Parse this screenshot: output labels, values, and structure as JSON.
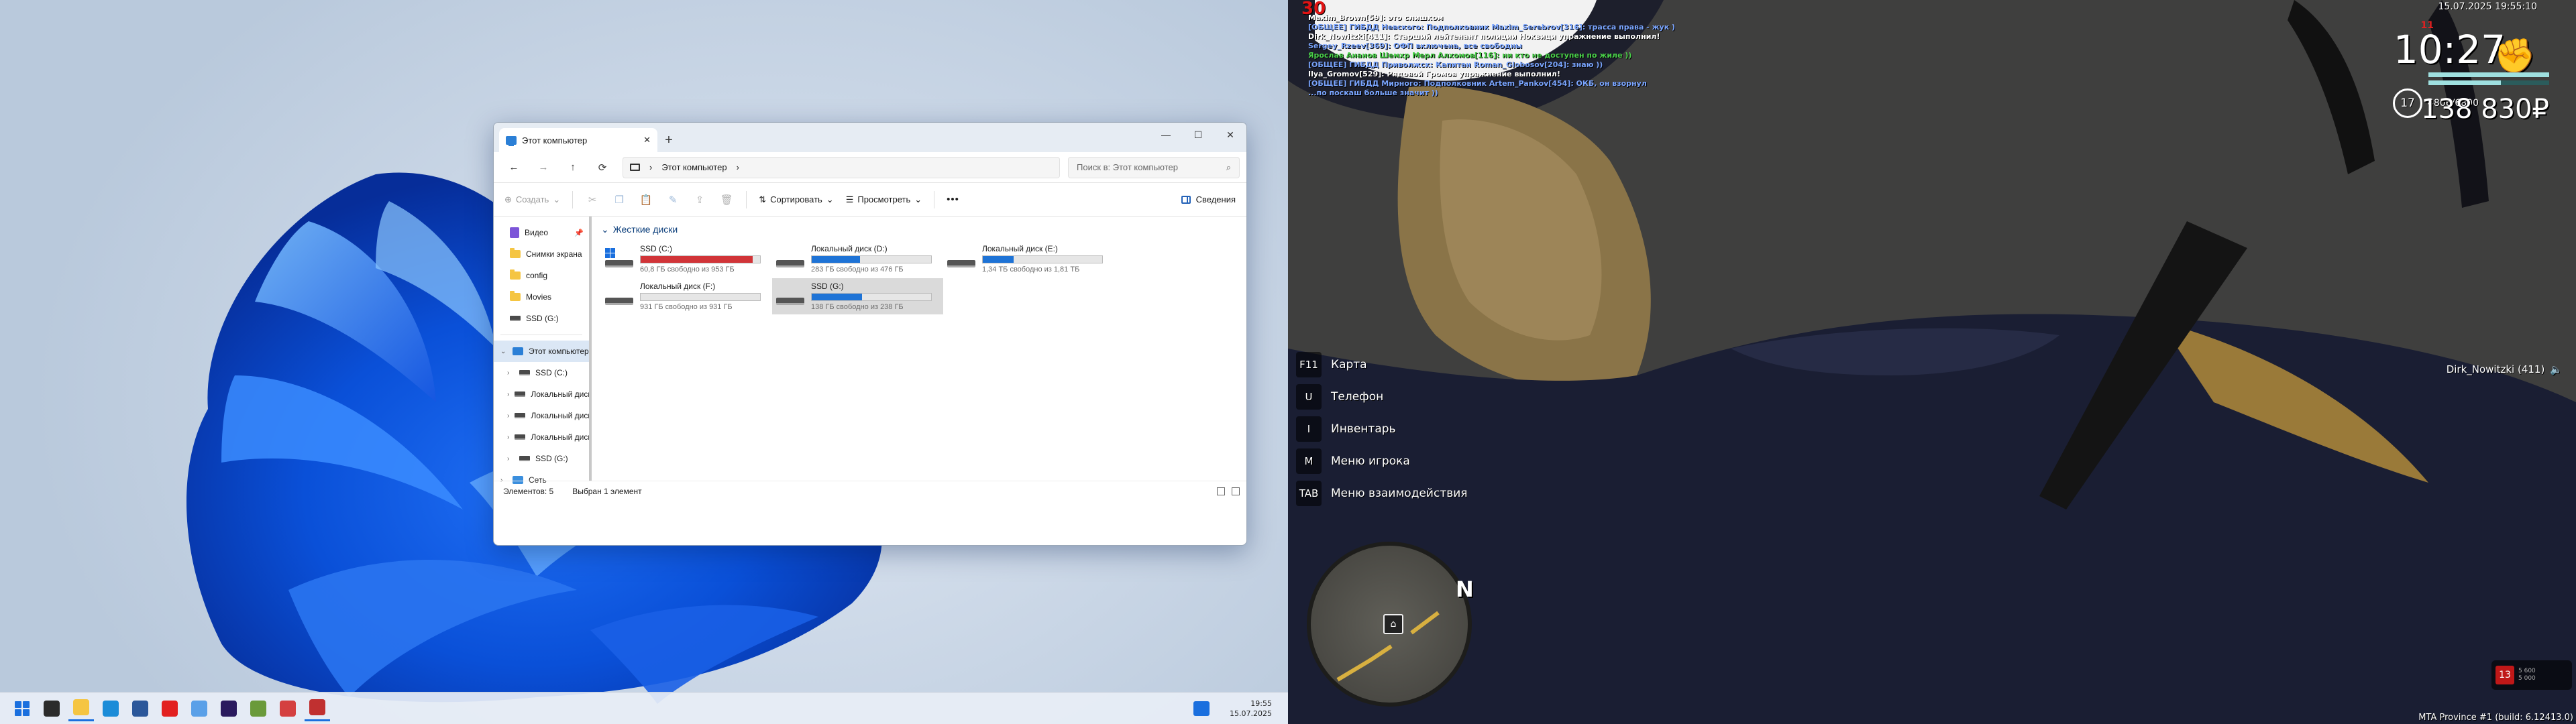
{
  "explorer": {
    "tab_title": "Этот компьютер",
    "tab_close": "✕",
    "tab_add": "+",
    "window_controls": {
      "minimize": "—",
      "maximize": "☐",
      "close": "✕"
    },
    "nav": {
      "back": "←",
      "forward": "→",
      "up": "↑",
      "refresh": "⟳"
    },
    "address": {
      "chevron": "›",
      "location": "Этот компьютер",
      "chevron2": "›"
    },
    "search_placeholder": "Поиск в: Этот компьютер",
    "toolbar": {
      "new": "Создать",
      "new_chevron": "⌄",
      "sort": "Сортировать",
      "sort_chevron": "⌄",
      "view": "Просмотреть",
      "view_chevron": "⌄",
      "more": "•••",
      "details": "Сведения"
    },
    "sidebar": {
      "quick": [
        {
          "label": "Видео",
          "icon": "video-icon",
          "pin": "📌"
        },
        {
          "label": "Снимки экрана",
          "icon": "folder-icon"
        },
        {
          "label": "config",
          "icon": "folder-icon"
        },
        {
          "label": "Movies",
          "icon": "folder-icon"
        },
        {
          "label": "SSD (G:)",
          "icon": "drive-icon"
        }
      ],
      "tree_root": {
        "label": "Этот компьютер",
        "chevron": "⌄"
      },
      "tree": [
        {
          "label": "SSD (C:)",
          "chevron": "›"
        },
        {
          "label": "Локальный диск (D:)",
          "chevron": "›"
        },
        {
          "label": "Локальный диск (E:)",
          "chevron": "›"
        },
        {
          "label": "Локальный диск (F:)",
          "chevron": "›"
        },
        {
          "label": "SSD (G:)",
          "chevron": "›"
        }
      ],
      "network": {
        "label": "Сеть",
        "chevron": "›"
      }
    },
    "group_header": "Жесткие диски",
    "group_chevron": "⌄",
    "drives": [
      {
        "name": "SSD (C:)",
        "free": "60,8 ГБ свободно из 953 ГБ",
        "used_fraction": 0.936,
        "color": "#d13438",
        "windows": true
      },
      {
        "name": "Локальный диск (D:)",
        "free": "283 ГБ свободно из 476 ГБ",
        "used_fraction": 0.405
      },
      {
        "name": "Локальный диск (E:)",
        "free": "1,34 ТБ свободно из 1,81 ТБ",
        "used_fraction": 0.26
      },
      {
        "name": "Локальный диск (F:)",
        "free": "931 ГБ свободно из 931 ГБ",
        "used_fraction": 0.0
      },
      {
        "name": "SSD (G:)",
        "free": "138 ГБ свободно из 238 ГБ",
        "used_fraction": 0.42,
        "selected": true
      }
    ],
    "status": {
      "items": "Элементов: 5",
      "selected": "Выбран 1 элемент"
    }
  },
  "taskbar": {
    "apps": [
      "start-icon",
      "task-view-icon",
      "file-explorer-icon",
      "edge-icon",
      "word-icon",
      "yandex-icon",
      "image-viewer-icon",
      "premiere-icon",
      "minecraft-icon",
      "game-launcher-icon",
      "mta-icon"
    ],
    "time": "19:55",
    "date": "15.07.2025"
  },
  "game": {
    "wanted_level": "30",
    "chat": [
      {
        "text": "Maxim_Brown[59]: это слишком",
        "color": "#ffffff"
      },
      {
        "text": "[ОБЩЕЕ] ГИБДД Невского: Подполковник Maxim_Serebrov[316]: трасса права - жук )",
        "color": "#7aa5ff"
      },
      {
        "text": "Dirk_Nowitzki[411]: Старший лейтенант полиции Ноквици упражнение выполнил!",
        "color": "#ffffff"
      },
      {
        "text": "Sergey_Rzeev[369]: ОФП включена, все свободны",
        "color": "#7aa5ff"
      },
      {
        "text": "Ярослав Ананов Шемхр Мерл Алхомов[116]: ни кто не доступен по жиле ))",
        "color": "#4ad14a"
      },
      {
        "text": "[ОБЩЕЕ] ГИБДД Приволжск: Капитан Roman_Globosov[204]: знаю ))",
        "color": "#7aa5ff"
      },
      {
        "text": "Ilya_Gromov[529]: Рядовой Громов упражнение выполнил!",
        "color": "#ffffff"
      },
      {
        "text": "[ОБЩЕЕ] ГИБДД Мирного: Подполковник Artem_Pankov[454]: ОКБ, он взорнул",
        "color": "#7aa5ff"
      },
      {
        "text": "...по поскаш больше значит ))",
        "color": "#7aa5ff"
      }
    ],
    "date": "15.07.2025 19:55:10",
    "stars": "11",
    "time": "10:27",
    "level": "17",
    "exp": "4806/6800",
    "money": "138 830₽",
    "health_fraction": 1.0,
    "armor_fraction": 0.6,
    "binds": [
      {
        "key": "F11",
        "label": "Карта"
      },
      {
        "key": "U",
        "label": "Телефон"
      },
      {
        "key": "I",
        "label": "Инвентарь"
      },
      {
        "key": "M",
        "label": "Меню игрока"
      },
      {
        "key": "TAB",
        "label": "Меню взаимодействия"
      }
    ],
    "player_tag": "Dirk_Nowitzki (411)",
    "speaker": "🔈",
    "radar_north": "N",
    "radar_blip": "⌂",
    "mini_hud": {
      "number": "13",
      "line1": "5 600",
      "line2": "5 000"
    },
    "build": "MTA Province #1 (build: 6.12413.0)"
  }
}
